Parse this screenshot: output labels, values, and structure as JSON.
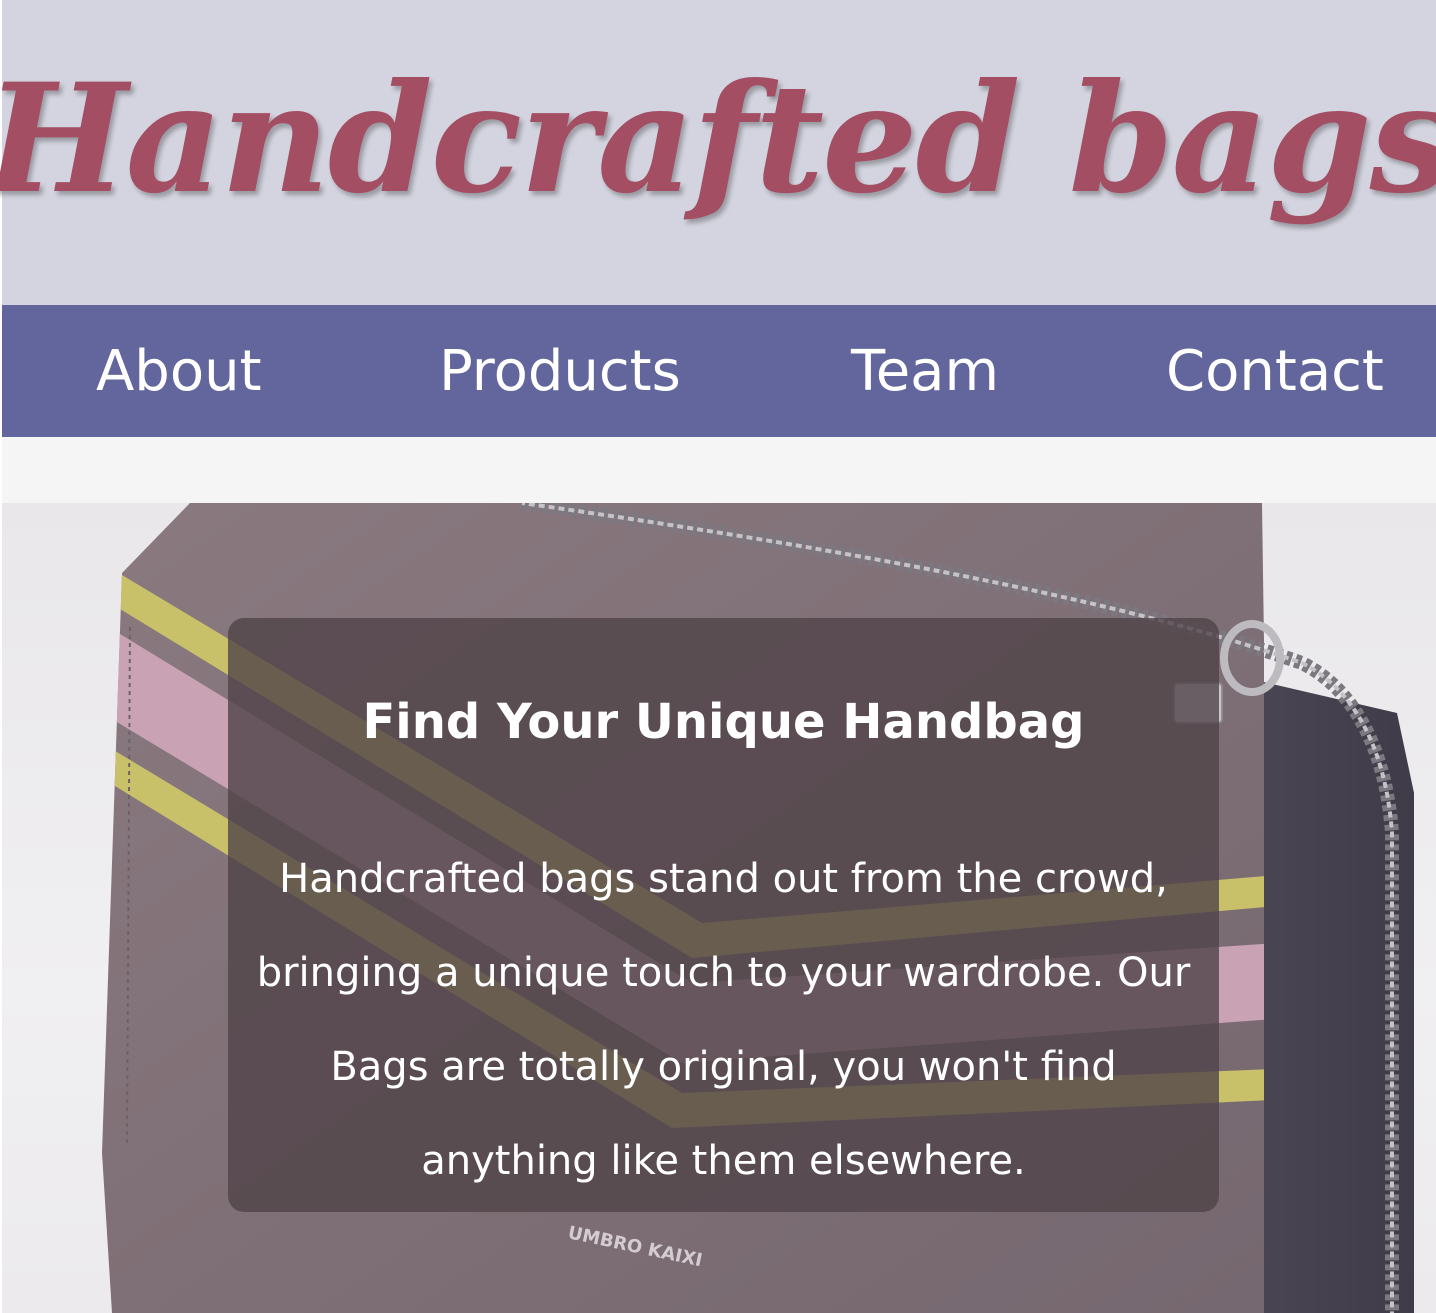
{
  "header": {
    "site_title": "Handcrafted bags"
  },
  "nav": {
    "items": [
      {
        "label": "About"
      },
      {
        "label": "Products"
      },
      {
        "label": "Team"
      },
      {
        "label": "Contact"
      }
    ]
  },
  "hero": {
    "heading": "Find Your Unique Handbag",
    "text": "Handcrafted bags stand out from the crowd, bringing a unique touch to your wardrobe. Our Bags are totally original, you won't find anything like them elsewhere.",
    "image_brand_text": "UMBRO KAIXI"
  },
  "colors": {
    "header_bg": "#d3d4df",
    "title": "#a44e63",
    "nav_bg": "#62669c",
    "nav_text": "#ffffff",
    "card_bg": "rgba(80,68,72,0.80)"
  }
}
